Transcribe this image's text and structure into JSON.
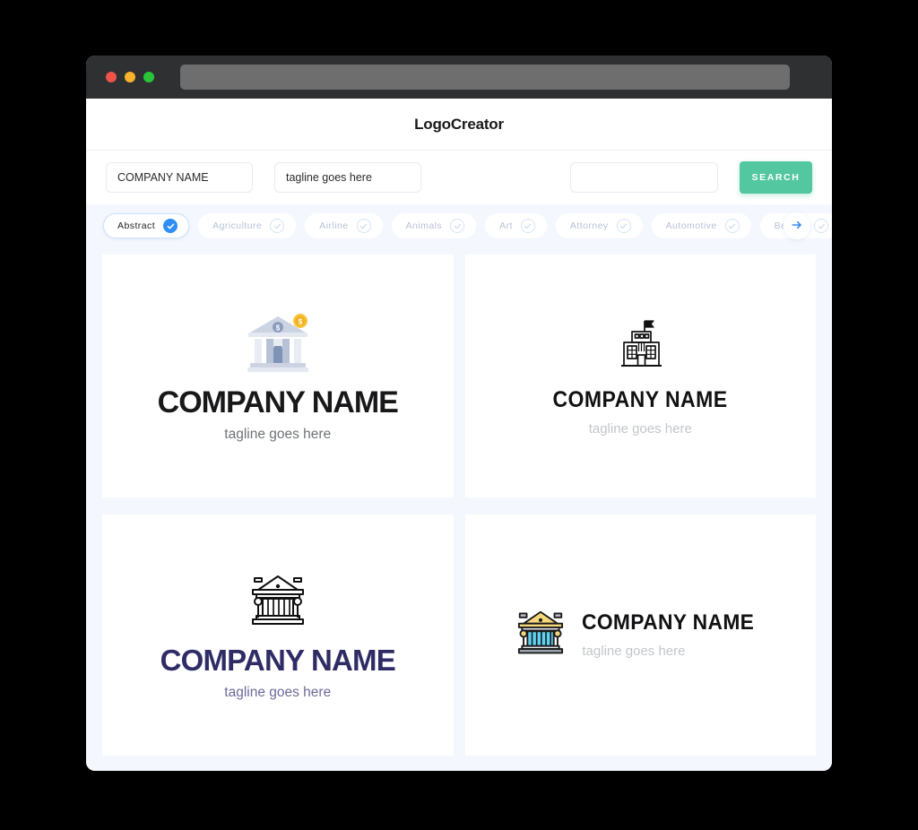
{
  "window": {
    "traffic_lights": [
      "close-red",
      "minimize-yellow",
      "maximize-green"
    ],
    "url_value": ""
  },
  "header": {
    "title": "LogoCreator"
  },
  "search": {
    "company_value": "COMPANY NAME",
    "company_placeholder": "COMPANY NAME",
    "tagline_value": "tagline goes here",
    "tagline_placeholder": "tagline goes here",
    "extra_value": "",
    "extra_placeholder": "",
    "button_label": "SEARCH",
    "button_color": "#53c7a0"
  },
  "tabs": {
    "next_icon": "arrow-right-icon",
    "active_index": 0,
    "items": [
      {
        "label": "Abstract",
        "active": true
      },
      {
        "label": "Agriculture",
        "active": false
      },
      {
        "label": "Airline",
        "active": false
      },
      {
        "label": "Animals",
        "active": false
      },
      {
        "label": "Art",
        "active": false
      },
      {
        "label": "Attorney",
        "active": false
      },
      {
        "label": "Automotive",
        "active": false
      },
      {
        "label": "Beauty",
        "active": false
      }
    ]
  },
  "results": {
    "cards": [
      {
        "icon": "bank-building-coin-icon",
        "title": "COMPANY NAME",
        "tagline": "tagline goes here",
        "title_color": "#18181a",
        "tagline_color": "#6f7277",
        "layout": "stacked"
      },
      {
        "icon": "government-building-flag-icon",
        "title": "COMPANY NAME",
        "tagline": "tagline goes here",
        "title_color": "#111113",
        "tagline_color": "#c3c6cb",
        "layout": "stacked"
      },
      {
        "icon": "courthouse-outline-icon",
        "title": "COMPANY NAME",
        "tagline": "tagline goes here",
        "title_color": "#2f2c65",
        "tagline_color": "#6b6a9a",
        "layout": "stacked"
      },
      {
        "icon": "courthouse-color-icon",
        "title": "COMPANY NAME",
        "tagline": "tagline goes here",
        "title_color": "#111113",
        "tagline_color": "#c3c6cb",
        "layout": "horizontal"
      }
    ]
  },
  "colors": {
    "page_background": "#f4f7fd",
    "card_background": "#ffffff",
    "accent_green": "#53c7a0",
    "accent_blue": "#2f8ff5",
    "titlebar": "#2f3031"
  }
}
